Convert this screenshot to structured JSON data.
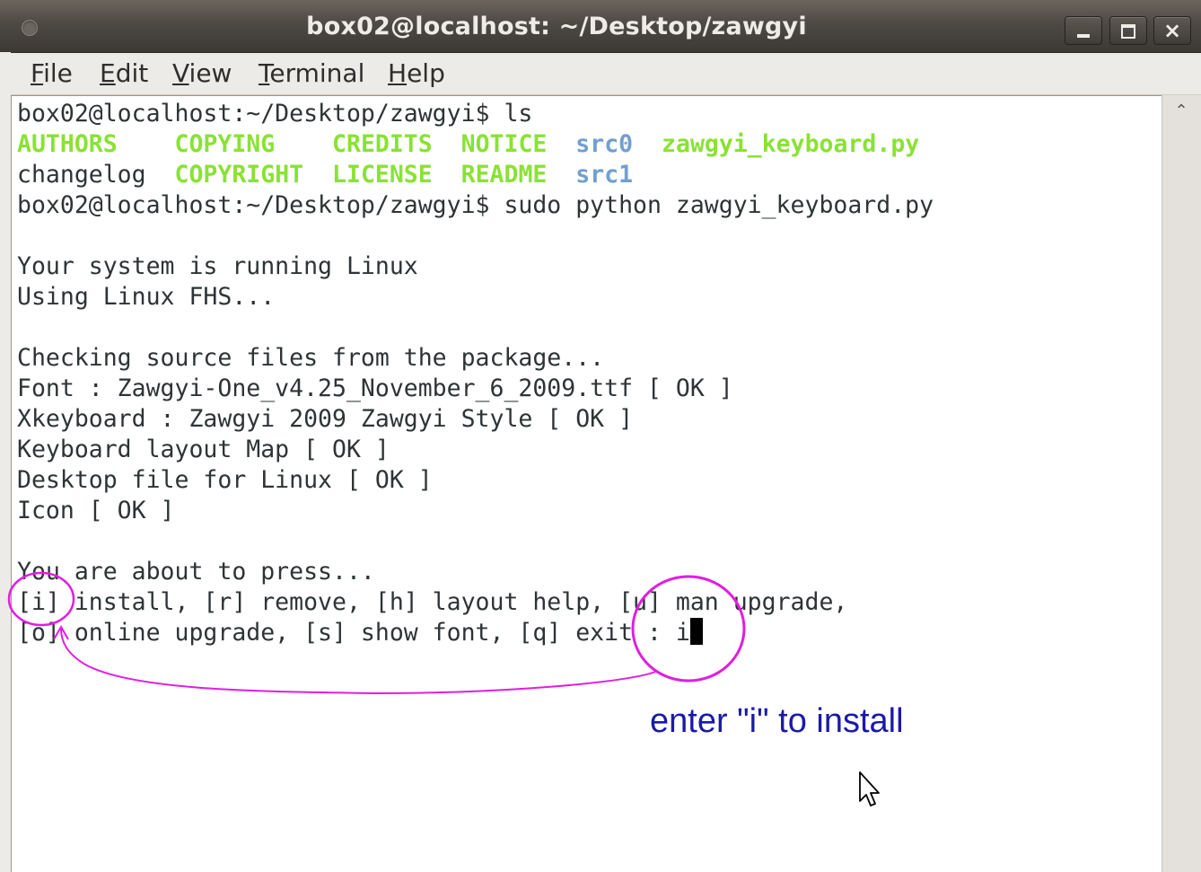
{
  "window": {
    "title": "box02@localhost: ~/Desktop/zawgyi",
    "controls": {
      "minimize": "_",
      "maximize": "□",
      "close": "×"
    }
  },
  "menu": [
    {
      "label_prefix": "",
      "mnemonic": "F",
      "label_rest": "ile"
    },
    {
      "label_prefix": "",
      "mnemonic": "E",
      "label_rest": "dit"
    },
    {
      "label_prefix": "",
      "mnemonic": "V",
      "label_rest": "iew"
    },
    {
      "label_prefix": "",
      "mnemonic": "T",
      "label_rest": "erminal"
    },
    {
      "label_prefix": "",
      "mnemonic": "H",
      "label_rest": "elp"
    }
  ],
  "terminal": {
    "prompt1": "box02@localhost:~/Desktop/zawgyi$ ls",
    "ls_row1": [
      "AUTHORS",
      "COPYING",
      "CREDITS",
      "NOTICE",
      "src0",
      "zawgyi_keyboard.py"
    ],
    "ls_row2": [
      "changelog",
      "COPYRIGHT",
      "LICENSE",
      "README",
      "src1"
    ],
    "prompt2": "box02@localhost:~/Desktop/zawgyi$ sudo python zawgyi_keyboard.py",
    "sys1": "Your system is running Linux",
    "sys2": "Using Linux FHS...",
    "check_header": "Checking source files from the package...",
    "check1": "Font : Zawgyi-One_v4.25_November_6_2009.ttf [ OK ]",
    "check2": "Xkeyboard : Zawgyi 2009 Zawgyi Style [ OK ]",
    "check3": "Keyboard layout Map [ OK ]",
    "check4": "Desktop file for Linux [ OK ]",
    "check5": "Icon [ OK ]",
    "press_header": "You are about to press...",
    "options1": "[i] install, [r] remove, [h] layout help, [u] man upgrade,",
    "options2": "[o] online upgrade, [s] show font, [q] exit : i"
  },
  "annotation": {
    "text": "enter \"i\" to install",
    "color": "#1a1aa8",
    "ink_color": "#e01ee0"
  },
  "colors": {
    "titlebar": "#4d4943",
    "terminal_bg": "#ffffff",
    "ls_green": "#8ae234",
    "ls_blue": "#729fcf",
    "text": "#2e3436"
  },
  "icons": {
    "scroll_up": "chevron-up-icon",
    "pointer": "mouse-pointer-icon"
  }
}
